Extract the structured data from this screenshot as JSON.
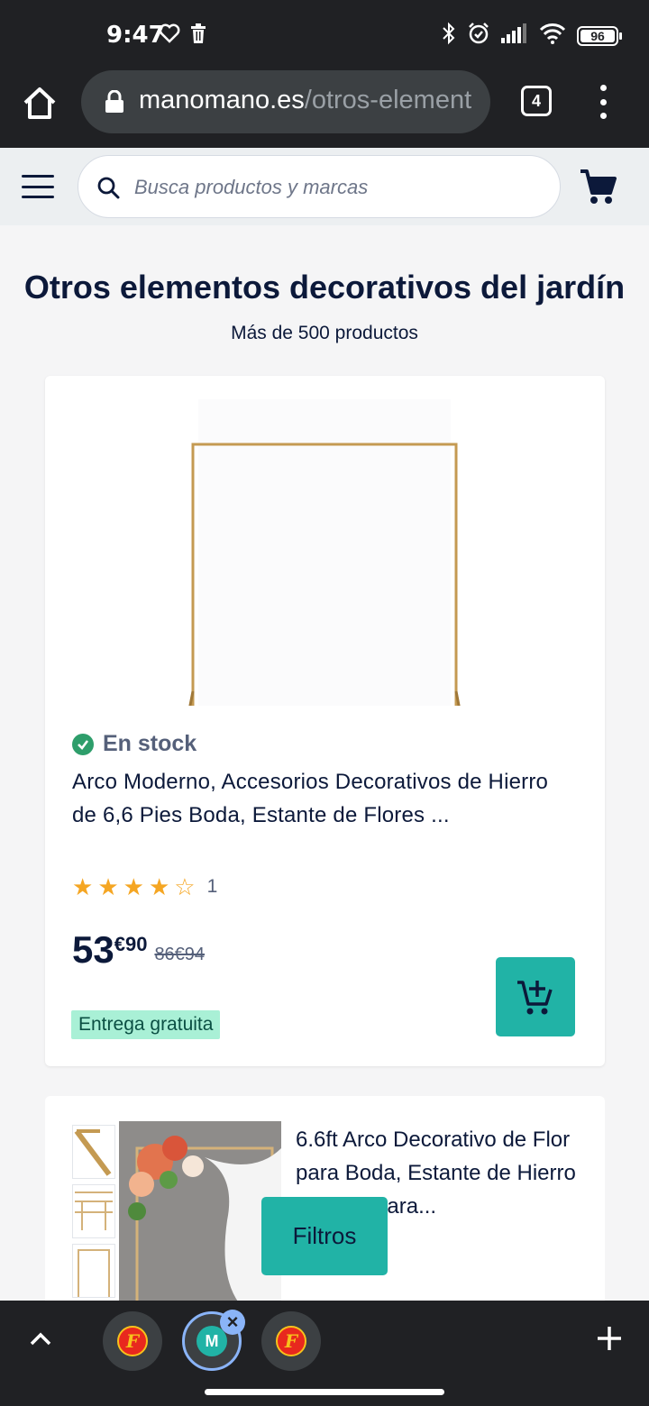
{
  "status_bar": {
    "time": "9:47",
    "battery": "96",
    "icons_left": [
      "heart-icon",
      "trash-icon"
    ],
    "icons_right": [
      "bluetooth-icon",
      "alarm-icon",
      "signal-icon",
      "wifi-icon",
      "battery-icon"
    ]
  },
  "browser": {
    "url_domain": "manomano.es",
    "url_path": "/otros-element",
    "tab_count": "4"
  },
  "header": {
    "search_placeholder": "Busca productos y marcas"
  },
  "page": {
    "title": "Otros elementos decorativos del jardín",
    "count": "Más de 500 productos"
  },
  "products": [
    {
      "stock": "En stock",
      "title": "Arco Moderno, Accesorios Decorativos de Hierro de 6,6 Pies Boda, Estante de Flores ...",
      "rating_value": 4,
      "rating_max": 5,
      "rating_count": "1",
      "price_int": "53",
      "price_dec": "€90",
      "price_old": "86€94",
      "shipping": "Entrega gratuita"
    },
    {
      "title": "6.6ft Arco Decorativo de Flor para Boda, Estante de Hierro Forjado para..."
    }
  ],
  "filters_label": "Filtros",
  "bottom_tabs": [
    {
      "icon": "fnac-favicon-icon",
      "letter": "F"
    },
    {
      "icon": "manomano-favicon-icon",
      "letter": "M",
      "active": true
    },
    {
      "icon": "fnac-favicon-icon",
      "letter": "F"
    }
  ],
  "colors": {
    "accent": "#21b3a6",
    "navy": "#0c193a",
    "stock_green": "#2e9e6b",
    "free_shipping_bg": "#a9f0d6",
    "star": "#f5a623"
  }
}
